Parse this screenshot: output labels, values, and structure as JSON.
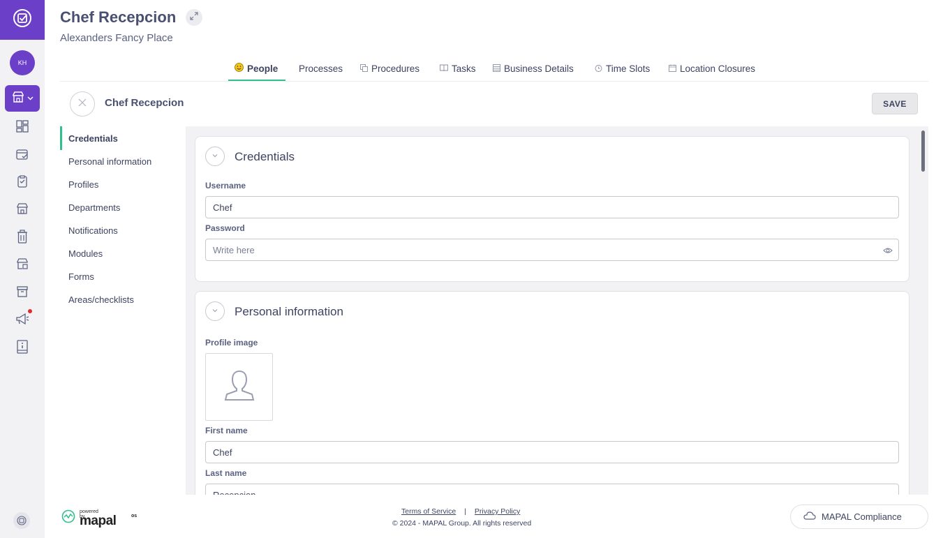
{
  "header": {
    "title": "Chef Recepcion",
    "subtitle": "Alexanders Fancy Place"
  },
  "user": {
    "initials": "KH"
  },
  "tabs": [
    {
      "label": "People",
      "icon": "smiley-icon",
      "active": true
    },
    {
      "label": "Processes",
      "icon": "",
      "active": false
    },
    {
      "label": "Procedures",
      "icon": "copy-icon",
      "active": false
    },
    {
      "label": "Tasks",
      "icon": "book-icon",
      "active": false
    },
    {
      "label": "Business Details",
      "icon": "list-icon",
      "active": false
    },
    {
      "label": "Time Slots",
      "icon": "clock-icon",
      "active": false
    },
    {
      "label": "Location Closures",
      "icon": "calendar-icon",
      "active": false
    }
  ],
  "form": {
    "title": "Chef Recepcion",
    "save_label": "SAVE"
  },
  "section_nav": [
    {
      "label": "Credentials",
      "active": true
    },
    {
      "label": "Personal information",
      "active": false
    },
    {
      "label": "Profiles",
      "active": false
    },
    {
      "label": "Departments",
      "active": false
    },
    {
      "label": "Notifications",
      "active": false
    },
    {
      "label": "Modules",
      "active": false
    },
    {
      "label": "Forms",
      "active": false
    },
    {
      "label": "Areas/checklists",
      "active": false
    }
  ],
  "credentials": {
    "title": "Credentials",
    "username_label": "Username",
    "username_value": "Chef",
    "password_label": "Password",
    "password_placeholder": "Write here"
  },
  "personal": {
    "title": "Personal information",
    "profile_image_label": "Profile image",
    "first_name_label": "First name",
    "first_name_value": "Chef",
    "last_name_label": "Last name",
    "last_name_value": "Recepcion"
  },
  "footer": {
    "powered_by": "powered by",
    "brand": "mapal",
    "brand_suffix": "os",
    "terms": "Terms of Service",
    "separator": "|",
    "privacy": "Privacy Policy",
    "copyright": "© 2024 - MAPAL Group. All rights reserved",
    "compliance": "MAPAL Compliance"
  },
  "colors": {
    "brand_purple": "#6c3fc9",
    "accent_green": "#2fc08b",
    "notification_red": "#e02b2b"
  }
}
